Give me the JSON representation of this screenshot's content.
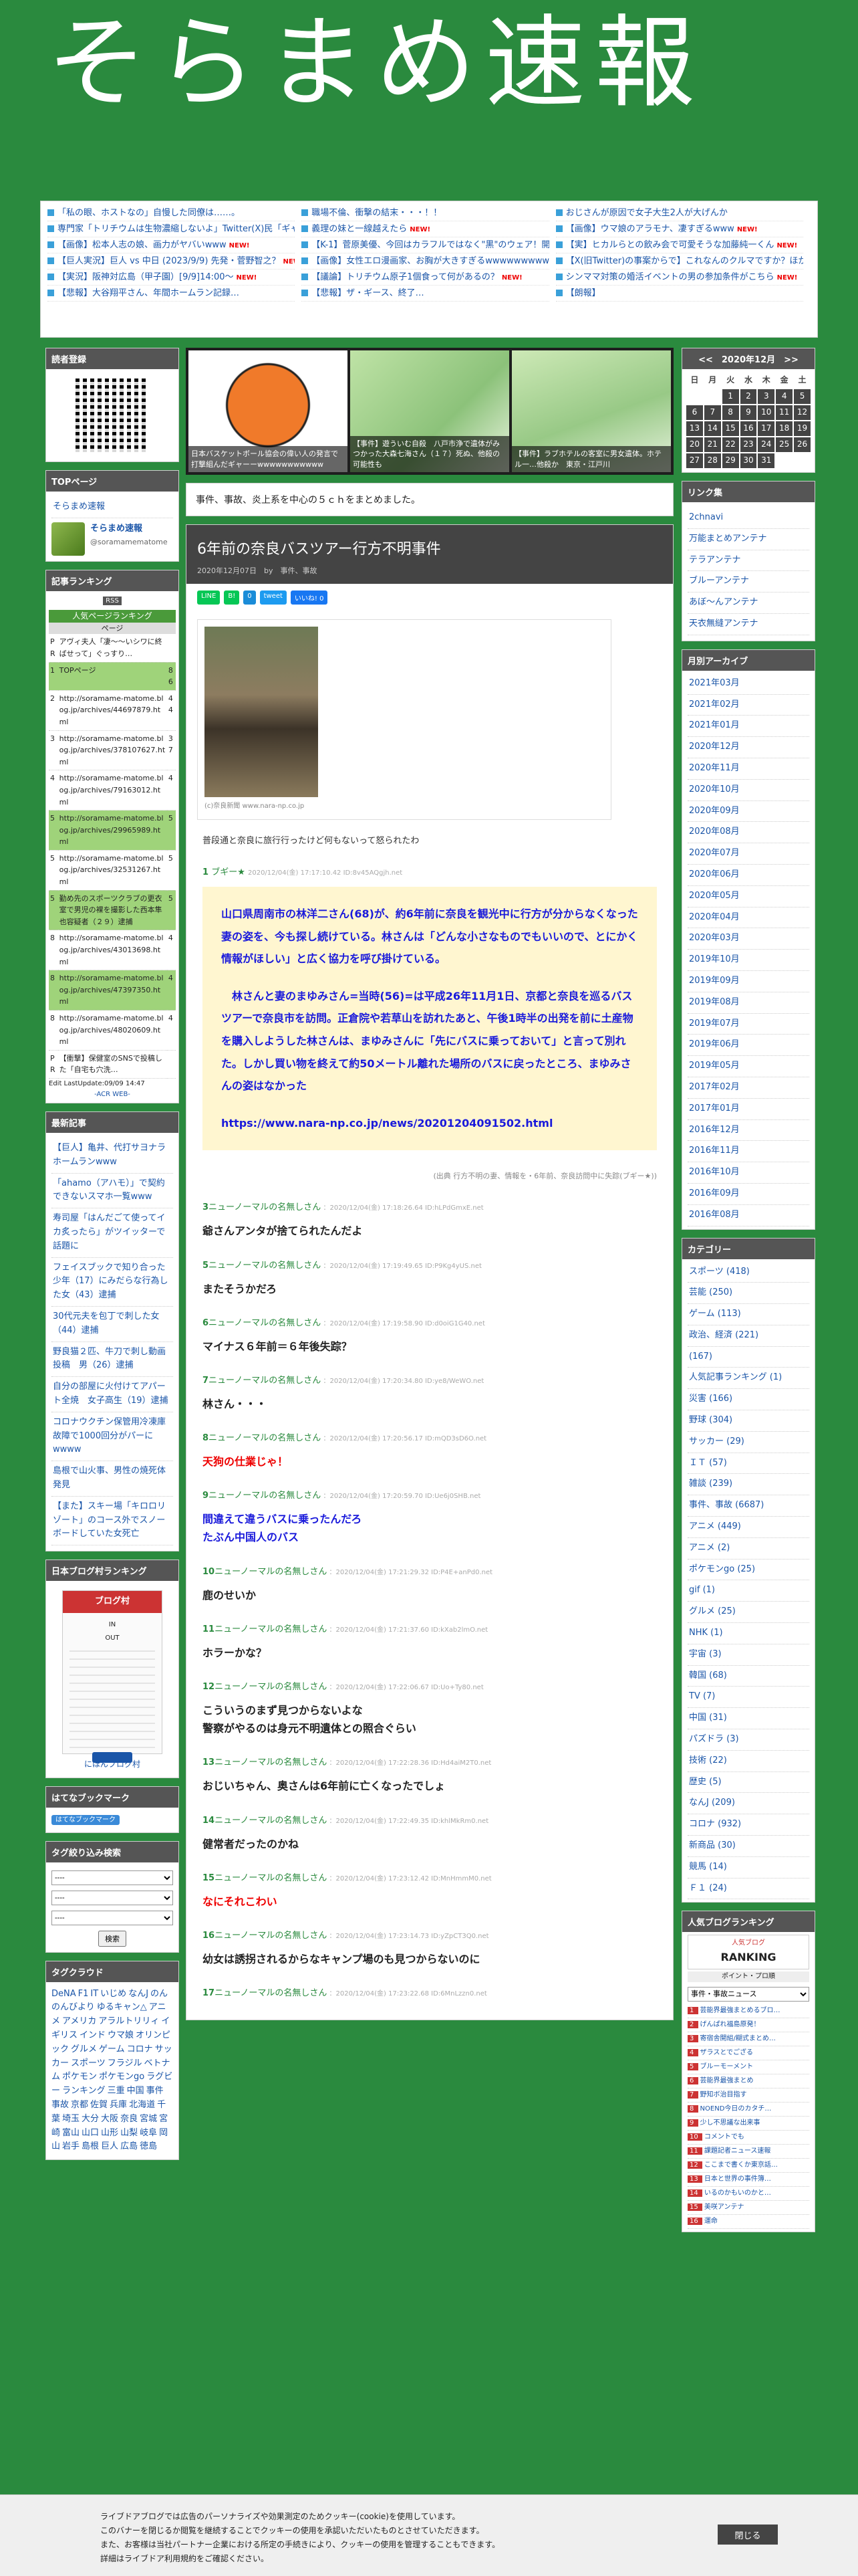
{
  "site": {
    "title": "そらまめ速報"
  },
  "antenna": {
    "col1": [
      {
        "text": "「私の眼、ホストなの」自慢した同僚は……。",
        "new": false
      },
      {
        "text": "専門家「トリチウムは生物濃縮しないよ」Twitter(X)民「ギャオオオ!!!」",
        "new": true
      },
      {
        "text": "【画像】松本人志の娘、画力がヤバいwww",
        "new": true
      },
      {
        "text": "【巨人実況】巨人 vs 中日 (2023/9/9) 先発・菅野智之？",
        "new": true
      },
      {
        "text": "【実況】阪神対広島（甲子園）[9/9]14:00〜",
        "new": true
      },
      {
        "text": "【悲報】大谷翔平さん、年間ホームラン記録…",
        "new": false
      }
    ],
    "col2": [
      {
        "text": "職場不倫、衝撃の結末・・・！！",
        "new": false
      },
      {
        "text": "義理の妹と一線越えたら",
        "new": true
      },
      {
        "text": "【K-1】菅原美優、今回はカラフルではなく\"黒\"のウェア！開閉パス、笑顔でガッツポーズ",
        "new": true
      },
      {
        "text": "【画像】女性エロ漫画家、お胸が大きすぎるwwwwwwwwwww",
        "new": true
      },
      {
        "text": "【議論】トリチウム原子1個食って何があるの？",
        "new": true
      },
      {
        "text": "【悲報】ザ・ギース、終了…",
        "new": false
      }
    ],
    "col3": [
      {
        "text": "おじさんが原因で女子大生2人が大げんか",
        "new": false
      },
      {
        "text": "【画像】ウマ娘のアラモナ、凄すぎるwww",
        "new": true
      },
      {
        "text": "【実】ヒカルらとの飲み会で可愛そうな加藤純一くん",
        "new": true
      },
      {
        "text": "【X(旧Twitter)の事案からで】これなんのクルマですか？ほか",
        "new": true
      },
      {
        "text": "シンママ対策の婚活イベントの男の参加条件がこちら",
        "new": true
      },
      {
        "text": "【朗報】",
        "new": false
      }
    ]
  },
  "left": {
    "reader": {
      "title": "読者登録"
    },
    "top": {
      "title": "TOPページ",
      "link": "そらまめ速報",
      "name": "そらまめ速報",
      "handle": "@soramamematome"
    },
    "ranking": {
      "title": "記事ランキング",
      "badge": "RSS",
      "header": "人気ページランキング",
      "sub": "ページ",
      "rows": [
        {
          "n": "PR",
          "t": "アヴィ夫人「凄〜〜いシワに終ばせって」ぐっすり…",
          "c": "",
          "hl": false
        },
        {
          "n": "1",
          "t": "TOPページ",
          "c": "86",
          "hl": true
        },
        {
          "n": "2",
          "t": "http://soramame-matome.blog.jp/archives/44697879.html",
          "c": "44",
          "hl": false
        },
        {
          "n": "3",
          "t": "http://soramame-matome.blog.jp/archives/378107627.html",
          "c": "37",
          "hl": false
        },
        {
          "n": "4",
          "t": "http://soramame-matome.blog.jp/archives/79163012.html",
          "c": "4",
          "hl": false
        },
        {
          "n": "5",
          "t": "http://soramame-matome.blog.jp/archives/29965989.html",
          "c": "5",
          "hl": true
        },
        {
          "n": "5",
          "t": "http://soramame-matome.blog.jp/archives/32531267.html",
          "c": "5",
          "hl": false
        },
        {
          "n": "5",
          "t": "勤め先のスポーツクラブの更衣室で男児の裸を撮影した西本隼也容疑者（２９）逮捕",
          "c": "5",
          "hl": true
        },
        {
          "n": "8",
          "t": "http://soramame-matome.blog.jp/archives/43013698.html",
          "c": "4",
          "hl": false
        },
        {
          "n": "8",
          "t": "http://soramame-matome.blog.jp/archives/47397350.html",
          "c": "4",
          "hl": true
        },
        {
          "n": "8",
          "t": "http://soramame-matome.blog.jp/archives/48020609.html",
          "c": "4",
          "hl": false
        },
        {
          "n": "PR",
          "t": "【衝撃】保健室のSNSで投稿した「自宅も穴洗…",
          "c": "",
          "hl": false
        }
      ],
      "footer": "Edit LastUpdate:09/09 14:47",
      "acr": "-ACR WEB-"
    },
    "latest": {
      "title": "最新記事",
      "items": [
        "【巨人】亀井、代打サヨナラホームランwww",
        "「ahamo（アハモ）」で契約できないスマホ一覧www",
        "寿司屋「はんだごて使ってイカ炙ったら」がツイッターで話題に",
        "フェイスブックで知り合った少年（17）にみだらな行為した女（43）逮捕",
        "30代元夫を包丁で刺した女（44）逮捕",
        "野良猫２匹、牛刀で刺し動画投稿　男（26）逮捕",
        "自分の部屋に火付けてアパート全焼　女子高生（19）逮捕",
        "コロナウクチン保管用冷凍庫故障で1000回分がパーにwwww",
        "島根で山火事、男性の焼死体発見",
        "【また】スキー場「キロロリゾート」のコース外でスノーボードしていた女死亡"
      ]
    },
    "blogrank": {
      "title": "日本ブログ村ランキング",
      "badge": "ブログ村",
      "in": "IN",
      "out": "OUT",
      "link": "にほんブログ村"
    },
    "hatena": {
      "title": "はてなブックマーク",
      "btn": "はてなブックマーク"
    },
    "tagsearch": {
      "title": "タグ絞り込み検索",
      "opt": "----",
      "btn": "検索"
    },
    "tagcloud": {
      "title": "タグクラウド",
      "tags": [
        "DeNA",
        "F1",
        "IT",
        "いじめ",
        "なんJ",
        "のんのんびより",
        "ゆるキャン△",
        "アニメ",
        "アメリカ",
        "アラルトリリィ",
        "イギリス",
        "インド",
        "ウマ娘",
        "オリンピック",
        "グルメ",
        "ゲーム",
        "コロナ",
        "サッカー",
        "スポーツ",
        "フラジル",
        "ベトナム",
        "ポケモン",
        "ポケモンgo",
        "ラグビー",
        "ランキング",
        "三重",
        "中国",
        "事件",
        "事故",
        "京都",
        "佐賀",
        "兵庫",
        "北海道",
        "千葉",
        "埼玉",
        "大分",
        "大阪",
        "奈良",
        "宮城",
        "宮崎",
        "富山",
        "山口",
        "山形",
        "山梨",
        "岐阜",
        "岡山",
        "岩手",
        "島根",
        "巨人",
        "広島",
        "徳島"
      ]
    }
  },
  "carousel": [
    {
      "cap": "日本バスケットボール協会の偉い人の発言で打撃組んだギャーーwwwwwwwwwww",
      "kind": "ball"
    },
    {
      "cap": "【事件】遊ういむ自殺　八戸市浄で遺体がみつかった大森七海さん（１７）死ぬ、他殺の可能性も",
      "kind": "map"
    },
    {
      "cap": "【事件】ラブホテルの客室に男女遺体。ホテル一…他殺か　東京・江戸川",
      "kind": "map2"
    }
  ],
  "desc": {
    "text": "事件、事故、炎上系を中心の５ｃｈをまとめました。"
  },
  "article": {
    "title": "6年前の奈良バスツアー行方不明事件",
    "meta": "2020年12月07日　by　事件、事故",
    "share": [
      "LINE",
      "B!",
      "0",
      "tweet",
      "いいね! 0"
    ],
    "photo_caption": "(c)奈良新聞 www.nara-np.co.jp",
    "lead": "普段通と奈良に旅行行ったけど何もないって怒られたわ",
    "first": {
      "num": "1",
      "name": "ブギー★",
      "date": "2020/12/04(金) 17:17:10.42 ID:8v45AQgjh.net"
    },
    "quote": [
      "山口県周南市の林洋二さん(68)が、約6年前に奈良を観光中に行方が分からなくなった妻の姿を、今も探し続けている。林さんは「どんな小さなものでもいいので、とにかく情報がほしい」と広く協力を呼び掛けている。",
      "林さんと妻のまゆみさん=当時(56)=は平成26年11月1日、京都と奈良を巡るバスツアーで奈良市を訪問。正倉院や若草山を訪れたあと、午後1時半の出発を前に土産物を購入しようした林さんは、まゆみさんに「先にバスに乗っておいて」と言って別れた。しかし買い物を終えて約50メートル離れた場所のバスに戻ったところ、まゆみさんの姿はなかった",
      "https://www.nara-np.co.jp/news/20201204091502.html"
    ],
    "tagline": "(出典 行方不明の妻、情報を・6年前、奈良訪問中に失踪(ブギー★))",
    "responses": [
      {
        "num": "3",
        "name": "ニューノーマルの名無しさん",
        "date": "2020/12/04(金) 17:18:26.64 ID:hLPdGmxE.net",
        "body": "爺さんアンタが捨てられたんだよ",
        "style": ""
      },
      {
        "num": "5",
        "name": "ニューノーマルの名無しさん",
        "date": "2020/12/04(金) 17:19:49.65 ID:P9Kg4yUS.net",
        "body": "またそうかだろ",
        "style": ""
      },
      {
        "num": "6",
        "name": "ニューノーマルの名無しさん",
        "date": "2020/12/04(金) 17:19:58.90 ID:d0oiG1G40.net",
        "body": "マイナス６年前＝６年後失踪？",
        "style": ""
      },
      {
        "num": "7",
        "name": "ニューノーマルの名無しさん",
        "date": "2020/12/04(金) 17:20:34.80 ID:ye8/WeWO.net",
        "body": "林さん・・・",
        "style": ""
      },
      {
        "num": "8",
        "name": "ニューノーマルの名無しさん",
        "date": "2020/12/04(金) 17:20:56.17 ID:mQD3sD6O.net",
        "body": "天狗の仕業じゃ！",
        "style": "red"
      },
      {
        "num": "9",
        "name": "ニューノーマルの名無しさん",
        "date": "2020/12/04(金) 17:20:59.70 ID:Ue6j0SHB.net",
        "body": "間違えて違うバスに乗ったんだろ\nたぶん中国人のバス",
        "style": "blue"
      },
      {
        "num": "10",
        "name": "ニューノーマルの名無しさん",
        "date": "2020/12/04(金) 17:21:29.32 ID:P4E+anPd0.net",
        "body": "鹿のせいか",
        "style": ""
      },
      {
        "num": "11",
        "name": "ニューノーマルの名無しさん",
        "date": "2020/12/04(金) 17:21:37.60 ID:kXab2lmO.net",
        "body": "ホラーかな？",
        "style": ""
      },
      {
        "num": "12",
        "name": "ニューノーマルの名無しさん",
        "date": "2020/12/04(金) 17:22:06.67 ID:Uo+Ty80.net",
        "body": "こういうのまず見つからないよな\n警察がやるのは身元不明遺体との照合ぐらい",
        "style": ""
      },
      {
        "num": "13",
        "name": "ニューノーマルの名無しさん",
        "date": "2020/12/04(金) 17:22:28.36 ID:Hd4aiM2T0.net",
        "body": "おじいちゃん、奥さんは6年前に亡くなったでしょ",
        "style": ""
      },
      {
        "num": "14",
        "name": "ニューノーマルの名無しさん",
        "date": "2020/12/04(金) 17:22:49.35 ID:khlMkRm0.net",
        "body": "健常者だったのかね",
        "style": ""
      },
      {
        "num": "15",
        "name": "ニューノーマルの名無しさん",
        "date": "2020/12/04(金) 17:23:12.42 ID:MnHmmM0.net",
        "body": "なにそれこわい",
        "style": "red"
      },
      {
        "num": "16",
        "name": "ニューノーマルの名無しさん",
        "date": "2020/12/04(金) 17:23:14.73 ID:yZpCT3Q0.net",
        "body": "幼女は誘拐されるからなキャンプ場のも見つからないのに",
        "style": ""
      },
      {
        "num": "17",
        "name": "ニューノーマルの名無しさん",
        "date": "2020/12/04(金) 17:23:22.68 ID:6MnLzzn0.net",
        "body": "",
        "style": ""
      }
    ]
  },
  "right": {
    "calendar": {
      "title": "<<　2020年12月　>>",
      "days": [
        "日",
        "月",
        "火",
        "水",
        "木",
        "金",
        "土"
      ],
      "weeks": [
        [
          "",
          "",
          "1",
          "2",
          "3",
          "4",
          "5"
        ],
        [
          "6",
          "7",
          "8",
          "9",
          "10",
          "11",
          "12"
        ],
        [
          "13",
          "14",
          "15",
          "16",
          "17",
          "18",
          "19"
        ],
        [
          "20",
          "21",
          "22",
          "23",
          "24",
          "25",
          "26"
        ],
        [
          "27",
          "28",
          "29",
          "30",
          "31",
          "",
          ""
        ]
      ]
    },
    "links": {
      "title": "リンク集",
      "items": [
        "2chnavi",
        "万能まとめアンテナ",
        "テラアンテナ",
        "ブルーアンテナ",
        "あぼ〜んアンテナ",
        "天衣無縫アンテナ"
      ]
    },
    "archive": {
      "title": "月別アーカイブ",
      "items": [
        "2021年03月",
        "2021年02月",
        "2021年01月",
        "2020年12月",
        "2020年11月",
        "2020年10月",
        "2020年09月",
        "2020年08月",
        "2020年07月",
        "2020年06月",
        "2020年05月",
        "2020年04月",
        "2020年03月",
        "2019年10月",
        "2019年09月",
        "2019年08月",
        "2019年07月",
        "2019年06月",
        "2019年05月",
        "2017年02月",
        "2017年01月",
        "2016年12月",
        "2016年11月",
        "2016年10月",
        "2016年09月",
        "2016年08月"
      ]
    },
    "category": {
      "title": "カテゴリー",
      "items": [
        "スポーツ (418)",
        "芸能 (250)",
        "ゲーム (113)",
        "政治、経済 (221)",
        "(167)",
        "人気記事ランキング (1)",
        "災害 (166)",
        "野球 (304)",
        "サッカー (29)",
        "ＩＴ (57)",
        "雑談 (239)",
        "事件、事故 (6687)",
        "アニメ (449)",
        "アニメ (2)",
        "ポケモンgo (25)",
        "gif (1)",
        "グルメ (25)",
        "NHK (1)",
        "宇宙 (3)",
        "韓国 (68)",
        "TV (7)",
        "中国 (31)",
        "パズドラ (3)",
        "技術 (22)",
        "歴史 (5)",
        "なんJ (209)",
        "コロナ (932)",
        "新商品 (30)",
        "競馬 (14)",
        "Ｆ１ (24)"
      ]
    },
    "popular": {
      "title": "人気ブログランキング",
      "badge": "人気ブログ",
      "rank": "RANKING",
      "sub": "ポイント・プロ順",
      "sel": "事件・事故ニュース",
      "items": [
        "芸能界最強まとめるブロ…",
        "げんぱれ福島原発！",
        "寄宿舎開組/糊式まとめ…",
        "ザラスとでござる",
        "ブルーモーメント",
        "芸能界最強まとめ",
        "野知ボ治目指す",
        "NOEND今日のカタチ…",
        "少し不思議な出来事",
        "コメントでも",
        "課題記者ニュース速報",
        "ここまで書くか東京話…",
        "日本と世界の事件簿…",
        "いるのかもいのかと…",
        "美咲アンテナ",
        "運命"
      ]
    }
  },
  "cookie": {
    "text": "ライブドアブログでは広告のパーソナライズや効果測定のためクッキー(cookie)を使用しています。\nこのバナーを閉じるか閲覧を継続することでクッキーの使用を承認いただいたものとさせていただきます。\nまた、お客様は当社パートナー企業における所定の手続きにより、クッキーの使用を管理することもできます。\n詳細はライブドア利用規約をご確認ください。",
    "btn": "閉じる"
  }
}
